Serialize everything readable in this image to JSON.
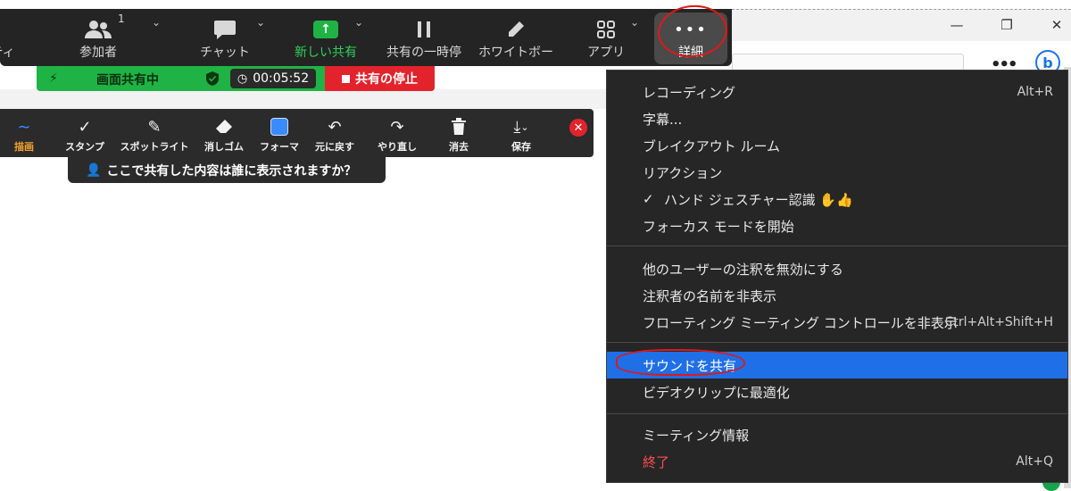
{
  "window": {
    "minimize_symbol": "—",
    "restore_symbol": "❐",
    "close_symbol": "✕"
  },
  "toolbar": {
    "left_partial_label": "ティ",
    "participants": {
      "label": "参加者",
      "count": "1"
    },
    "chat": {
      "label": "チャット"
    },
    "new_share": {
      "label": "新しい共有"
    },
    "pause_share": {
      "label": "共有の一時停"
    },
    "whiteboard": {
      "label": "ホワイトボー"
    },
    "apps": {
      "label": "アプリ"
    },
    "details": {
      "label": "詳細"
    },
    "accent_green": "#1fb345"
  },
  "share_status": {
    "label": "画面共有中",
    "timer": "00:05:52",
    "stop_label": "共有の停止"
  },
  "annotation": {
    "items": [
      {
        "label": "描画",
        "icon": "draw-wave-icon"
      },
      {
        "label": "スタンプ",
        "icon": "check-stamp-icon"
      },
      {
        "label": "スポットライト",
        "icon": "spotlight-wand-icon"
      },
      {
        "label": "消しゴム",
        "icon": "eraser-icon"
      },
      {
        "label": "フォーマ",
        "icon": "format-color-icon"
      },
      {
        "label": "元に戻す",
        "icon": "undo-icon"
      },
      {
        "label": "やり直し",
        "icon": "redo-icon"
      },
      {
        "label": "消去",
        "icon": "trash-icon"
      },
      {
        "label": "保存",
        "icon": "save-icon"
      }
    ],
    "who_sees_label": "ここで共有した内容は誰に表示されますか？"
  },
  "menu": {
    "group1": [
      {
        "label": "レコーディング",
        "shortcut": "Alt+R"
      },
      {
        "label": "字幕..."
      },
      {
        "label": "ブレイクアウト ルーム"
      },
      {
        "label": "リアクション"
      },
      {
        "label": "ハンド ジェスチャー認識 ✋👍",
        "checked": true
      },
      {
        "label": "フォーカス モードを開始"
      }
    ],
    "group2": [
      {
        "label": "他のユーザーの注釈を無効にする"
      },
      {
        "label": "注釈者の名前を非表示"
      },
      {
        "label": "フローティング ミーティング コントロールを非表示",
        "shortcut": "Ctrl+Alt+Shift+H"
      }
    ],
    "group3": [
      {
        "label": "サウンドを共有",
        "selected": true
      },
      {
        "label": "ビデオクリップに最適化"
      }
    ],
    "group4": [
      {
        "label": "ミーティング情報"
      },
      {
        "label": "終了",
        "shortcut": "Alt+Q",
        "danger": true
      }
    ],
    "check_mark": "✓",
    "highlight_color": "#1f6fe6",
    "danger_color": "#ff4d4d"
  },
  "browser_behind": {
    "more_symbol": "•••",
    "bing_letter": "b"
  }
}
